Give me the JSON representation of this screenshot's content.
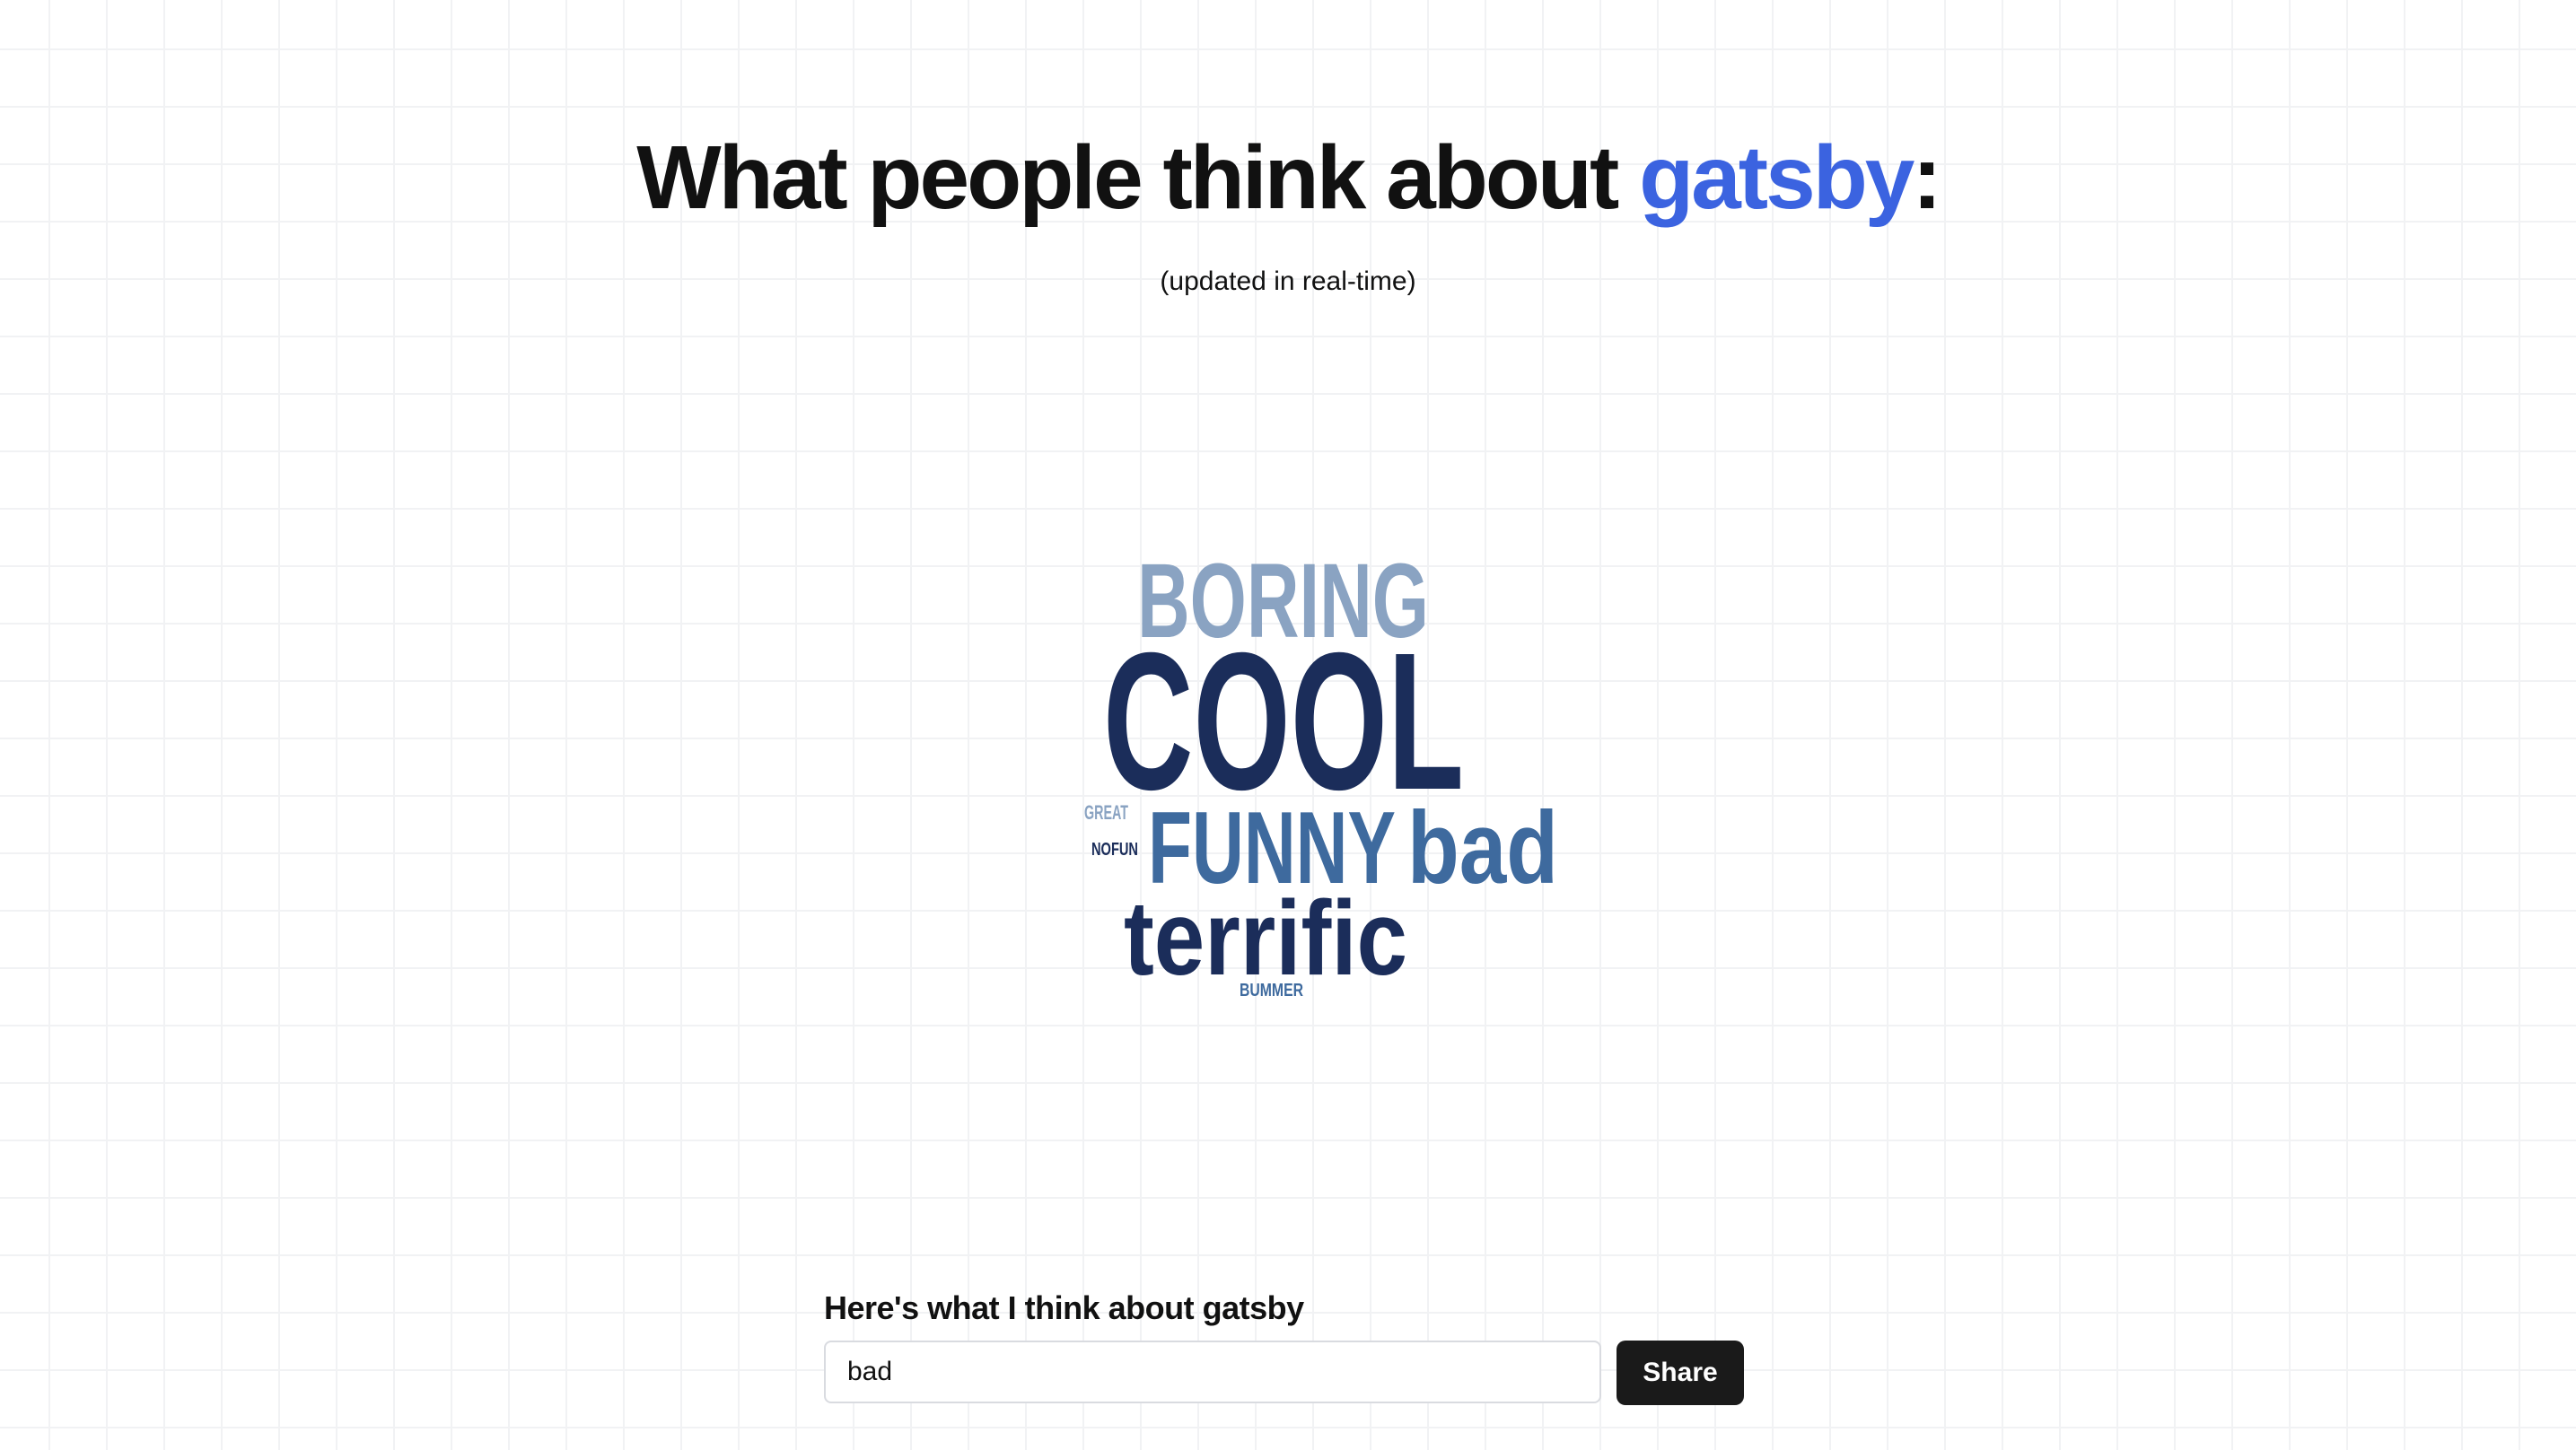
{
  "header": {
    "title_prefix": "What people think about ",
    "title_topic": "gatsby",
    "title_suffix": ":",
    "subtitle": "(updated in real-time)"
  },
  "word_cloud": {
    "words": [
      {
        "text": "BORING",
        "color": "#8aa3c2"
      },
      {
        "text": "COOL",
        "color": "#1b2d5a"
      },
      {
        "text": "GREAT",
        "color": "#8aa3c2"
      },
      {
        "text": "NOFUN",
        "color": "#1b2d5a"
      },
      {
        "text": "FUNNY",
        "color": "#3e6a9e"
      },
      {
        "text": "bad",
        "color": "#3e6a9e"
      },
      {
        "text": "terrific",
        "color": "#1b2d5a"
      },
      {
        "text": "BUMMER",
        "color": "#3e6a9e"
      }
    ]
  },
  "form": {
    "label": "Here's what I think about gatsby",
    "input_value": "bad",
    "share_label": "Share"
  },
  "colors": {
    "accent": "#3b63e0",
    "button_bg": "#1a1a1a"
  }
}
